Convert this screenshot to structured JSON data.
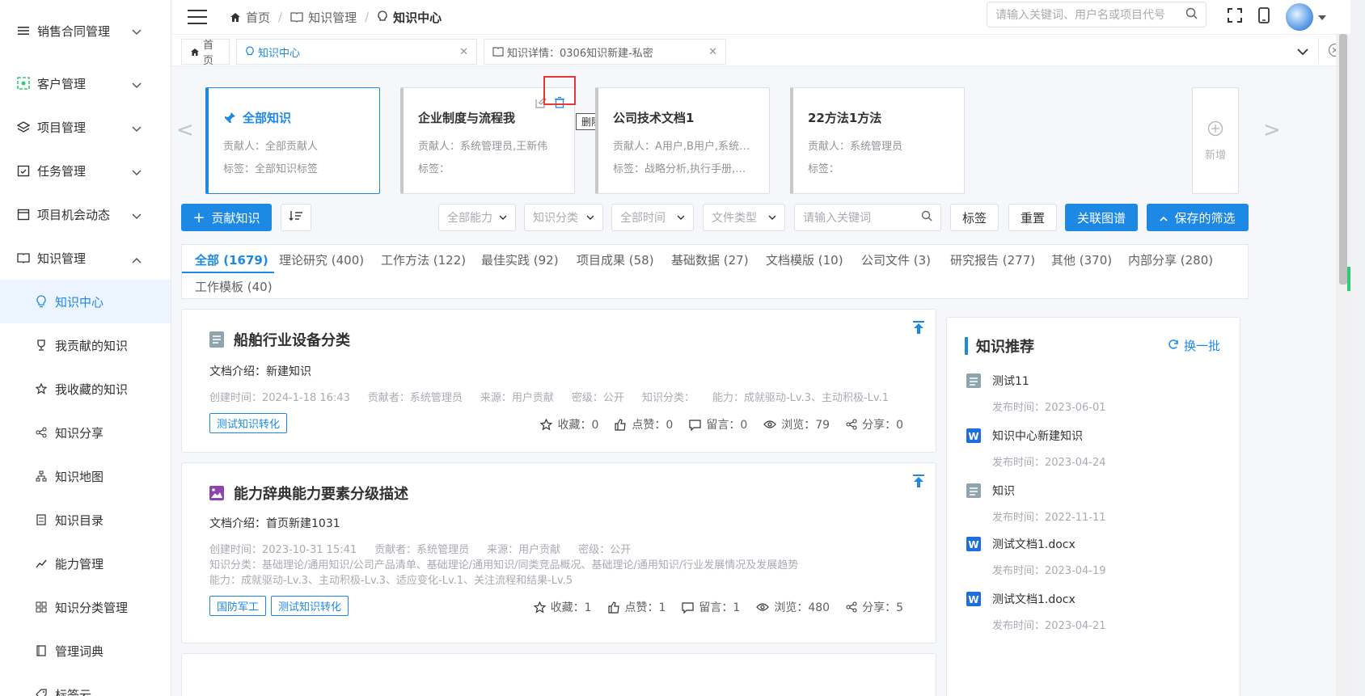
{
  "sidebar": {
    "items": [
      {
        "label": "销售合同管理",
        "icon": "list-icon"
      },
      {
        "label": "客户管理",
        "icon": "users-icon"
      },
      {
        "label": "项目管理",
        "icon": "layers-icon"
      },
      {
        "label": "任务管理",
        "icon": "calendar-check-icon"
      },
      {
        "label": "项目机会动态",
        "icon": "calendar-icon"
      },
      {
        "label": "知识管理",
        "icon": "book-icon"
      }
    ],
    "sub_items": [
      {
        "label": "知识中心",
        "icon": "bulb-icon"
      },
      {
        "label": "我贡献的知识",
        "icon": "trophy-icon"
      },
      {
        "label": "我收藏的知识",
        "icon": "star-icon"
      },
      {
        "label": "知识分享",
        "icon": "share-icon"
      },
      {
        "label": "知识地图",
        "icon": "sitemap-icon"
      },
      {
        "label": "知识目录",
        "icon": "catalog-icon"
      },
      {
        "label": "能力管理",
        "icon": "trend-icon"
      },
      {
        "label": "知识分类管理",
        "icon": "grid-icon"
      },
      {
        "label": "管理词典",
        "icon": "dictionary-icon"
      },
      {
        "label": "标签云",
        "icon": "tag-icon"
      }
    ]
  },
  "breadcrumb": {
    "home": "首页",
    "mid": "知识管理",
    "current": "知识中心"
  },
  "top_search": {
    "placeholder": "请输入关键词、用户名或项目代号"
  },
  "tabs": {
    "home": "首页",
    "center": "知识中心",
    "detail": "知识详情：0306知识新建-私密"
  },
  "cards": [
    {
      "title": "全部知识",
      "contrib": "贡献人：全部贡献人",
      "tag": "标签：全部知识标签"
    },
    {
      "title": "企业制度与流程我",
      "contrib": "贡献人：系统管理员,王新伟",
      "tag": "标签："
    },
    {
      "title": "公司技术文档1",
      "contrib": "贡献人：A用户,B用户,系统管...",
      "tag": "标签：战略分析,执行手册,质..."
    },
    {
      "title": "22方法1方法",
      "contrib": "贡献人：系统管理员",
      "tag": "标签："
    }
  ],
  "tooltip": "删除",
  "add_card": "新增",
  "toolbar": {
    "contribute": "贡献知识",
    "sel1": "全部能力",
    "sel2": "知识分类",
    "sel3": "全部时间",
    "sel4": "文件类型",
    "keyword": "请输入关键词",
    "tag": "标签",
    "reset": "重置",
    "graph": "关联图谱",
    "saved": "保存的筛选"
  },
  "categories": [
    "全部 (1679)",
    "理论研究 (400)",
    "工作方法 (122)",
    "最佳实践 (92)",
    "项目成果 (58)",
    "基础数据 (27)",
    "文档模版 (10)",
    "公司文件 (3)",
    "研究报告 (277)",
    "其他 (370)",
    "内部分享 (280)",
    "工作模板 (40)"
  ],
  "items": [
    {
      "title": "船舶行业设备分类",
      "intro": "文档介绍：新建知识",
      "meta1": [
        "创建时间：2024-1-18 16:43",
        "贡献者：系统管理员",
        "来源：用户贡献",
        "密级：公开",
        "知识分类：",
        "能力：成就驱动-Lv.3、主动积极-Lv.1"
      ],
      "tags": [
        "测试知识转化"
      ],
      "stats": {
        "fav": "收藏：0",
        "like": "点赞：0",
        "comment": "留言：0",
        "view": "浏览：79",
        "share": "分享：0"
      }
    },
    {
      "title": "能力辞典能力要素分级描述",
      "intro": "文档介绍：首页新建1031",
      "meta1": [
        "创建时间：2023-10-31 15:41",
        "贡献者：系统管理员",
        "来源：用户贡献",
        "密级：公开"
      ],
      "meta2": "知识分类：基础理论/通用知识/公司产品清单、基础理论/通用知识/同类竞品概况、基础理论/通用知识/行业发展情况及发展趋势",
      "meta3": "能力：成就驱动-Lv.3、主动积极-Lv.3、适应变化-Lv.1、关注流程和结果-Lv.5",
      "tags": [
        "国防军工",
        "测试知识转化"
      ],
      "stats": {
        "fav": "收藏：1",
        "like": "点赞：1",
        "comment": "留言：1",
        "view": "浏览：480",
        "share": "分享：5"
      }
    }
  ],
  "recommend": {
    "title": "知识推荐",
    "refresh": "换一批",
    "items": [
      {
        "name": "测试11",
        "date": "发布时间：2023-06-01",
        "icon": "doc-icon"
      },
      {
        "name": "知识中心新建知识",
        "date": "发布时间：2023-04-24",
        "icon": "word-icon"
      },
      {
        "name": "知识",
        "date": "发布时间：2022-11-11",
        "icon": "doc-icon"
      },
      {
        "name": "测试文档1.docx",
        "date": "发布时间：2023-04-19",
        "icon": "word-icon"
      },
      {
        "name": "测试文档1.docx",
        "date": "发布时间：2023-04-21",
        "icon": "word-icon"
      }
    ]
  }
}
